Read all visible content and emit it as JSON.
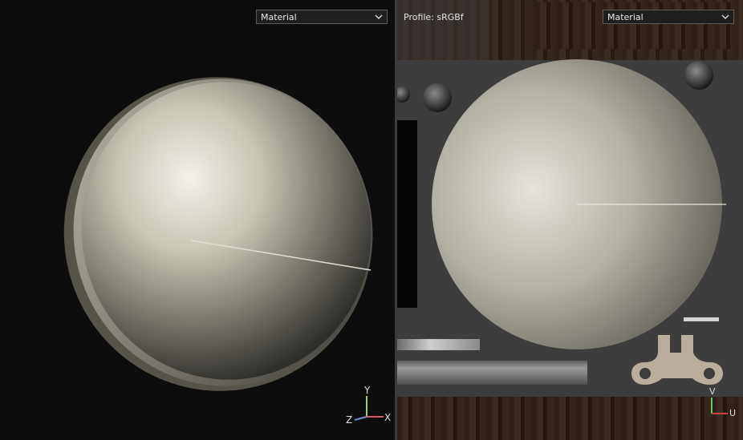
{
  "viewport3d": {
    "material_dropdown": "Material",
    "axis_labels": {
      "y": "Y",
      "z": "Z",
      "x": "X"
    },
    "colors": {
      "y": "#9ad06a",
      "z": "#6a8ed6",
      "x": "#d06060"
    }
  },
  "viewport2d": {
    "profile_label": "Profile: sRGBf",
    "material_dropdown": "Material",
    "axis_labels": {
      "v": "V",
      "u": "U"
    },
    "colors": {
      "v": "#5ad05a",
      "u": "#d04040"
    }
  },
  "icons": {
    "dropdown_chevron": "chevron-down-icon"
  }
}
